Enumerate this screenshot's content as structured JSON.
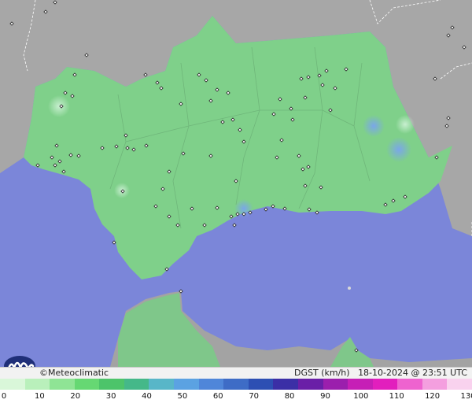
{
  "map": {
    "credit": "©Meteoclimatic",
    "variable": "DGST (km/h)",
    "datetime": "18-10-2024 @ 23:51 UTC"
  },
  "scale": {
    "labels": [
      "0",
      "10",
      "20",
      "30",
      "40",
      "50",
      "60",
      "70",
      "80",
      "90",
      "100",
      "110",
      "120",
      "130"
    ],
    "colors": [
      "#d9f7d9",
      "#b9f0bb",
      "#8fe495",
      "#66d873",
      "#4dc46a",
      "#45b889",
      "#58b6c8",
      "#5ba2e2",
      "#4f86d9",
      "#3e6cc6",
      "#2d4fb3",
      "#3b2fa6",
      "#6a1fa7",
      "#9b1fad",
      "#c61fb6",
      "#e21fbd",
      "#ee63cf",
      "#f49fdf",
      "#f9d2ee"
    ],
    "colors_per_label_gap": 1.4
  }
}
